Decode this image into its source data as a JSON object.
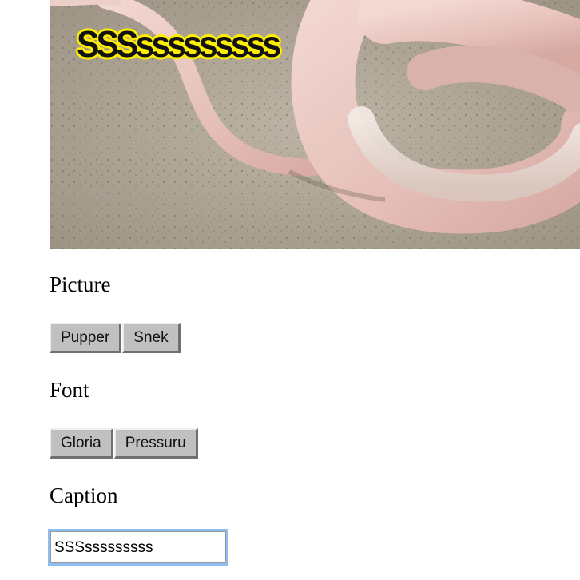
{
  "meme": {
    "overlay_text": "SSSsssssssss",
    "image_subject": "snek"
  },
  "picture_section": {
    "label": "Picture",
    "buttons": [
      "Pupper",
      "Snek"
    ]
  },
  "font_section": {
    "label": "Font",
    "buttons": [
      "Gloria",
      "Pressuru"
    ]
  },
  "caption_section": {
    "label": "Caption",
    "input_value": "SSSsssssssss"
  },
  "colors": {
    "caption_outline": "#ffee00",
    "button_face": "#c0c0c0",
    "focus_ring": "#8dbdf3"
  }
}
